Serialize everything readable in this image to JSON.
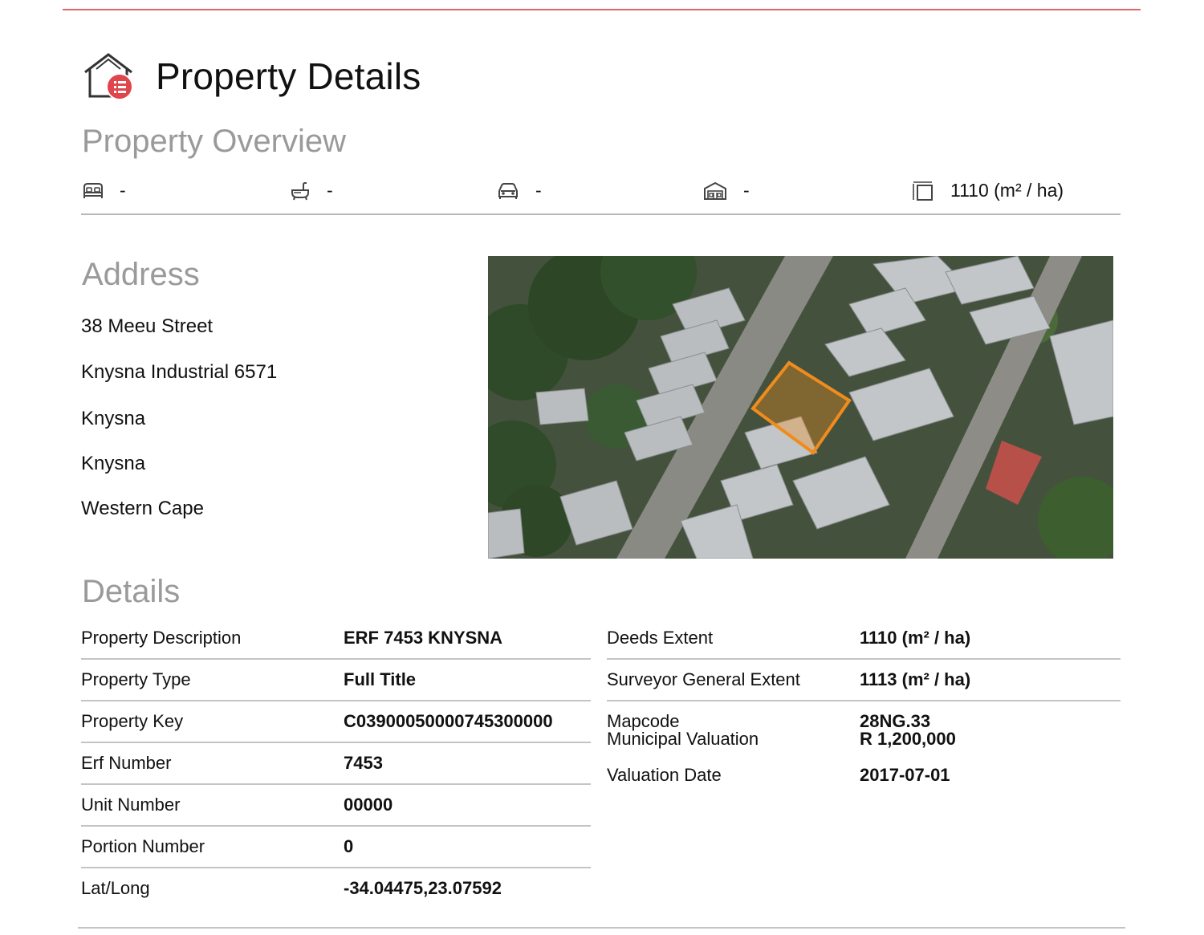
{
  "page": {
    "title": "Property Details",
    "accent_color": "#e0454b",
    "header_icon": "house-list-icon"
  },
  "overview": {
    "heading": "Property Overview",
    "items": [
      {
        "icon": "bed-icon",
        "value": "-"
      },
      {
        "icon": "bath-icon",
        "value": "-"
      },
      {
        "icon": "car-icon",
        "value": "-"
      },
      {
        "icon": "garage-icon",
        "value": "-"
      },
      {
        "icon": "floor-area-icon",
        "value": "1110 (m² / ha)"
      }
    ]
  },
  "address": {
    "heading": "Address",
    "lines": [
      "38 Meeu Street",
      "Knysna Industrial 6571",
      "Knysna",
      "Knysna",
      "Western Cape"
    ]
  },
  "map": {
    "type": "satellite-image",
    "highlight_color": "#f08c1e"
  },
  "details": {
    "heading": "Details",
    "left": [
      {
        "label": "Property Description",
        "value": "ERF 7453 KNYSNA"
      },
      {
        "label": "Property Type",
        "value": "Full Title"
      },
      {
        "label": "Property Key",
        "value": "C03900050000745300000"
      },
      {
        "label": "Erf Number",
        "value": "7453"
      },
      {
        "label": "Unit Number",
        "value": "00000"
      },
      {
        "label": "Portion Number",
        "value": "0"
      },
      {
        "label": "Lat/Long",
        "value": "-34.04475,23.07592"
      }
    ],
    "right": [
      {
        "label": "Deeds Extent",
        "value": "1110 (m² / ha)"
      },
      {
        "label": "Surveyor General Extent",
        "value": "1113 (m² / ha)"
      },
      {
        "label": "Mapcode",
        "value": "28NG.33"
      },
      {
        "label": "Municipal Valuation",
        "value": "R 1,200,000"
      },
      {
        "label": "Valuation Date",
        "value": "2017-07-01"
      }
    ]
  }
}
